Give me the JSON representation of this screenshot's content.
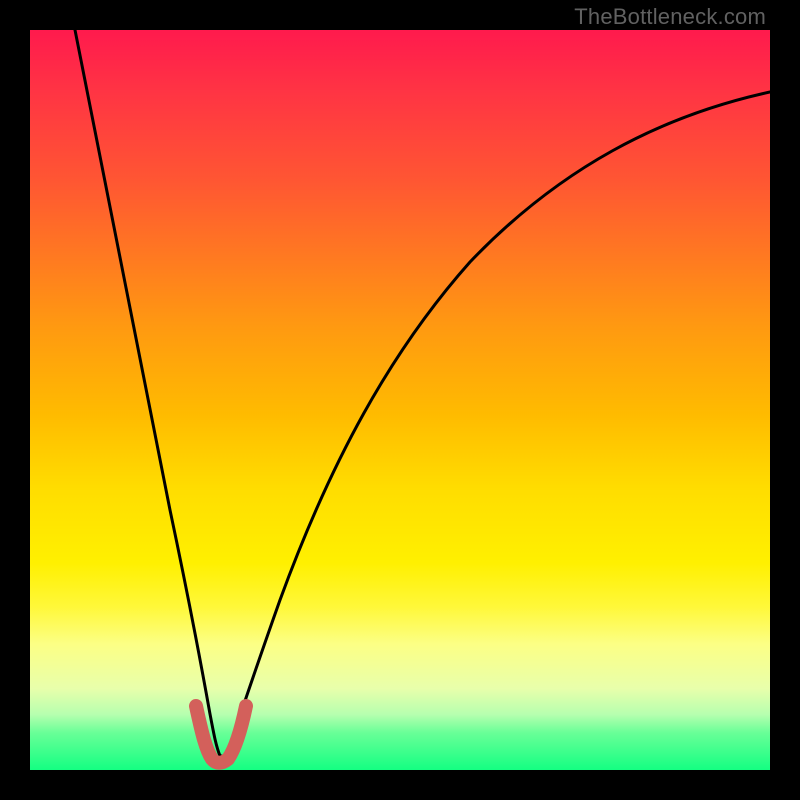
{
  "watermark": "TheBottleneck.com",
  "chart_data": {
    "type": "line",
    "title": "",
    "xlabel": "",
    "ylabel": "",
    "xlim": [
      0,
      100
    ],
    "ylim": [
      0,
      100
    ],
    "series": [
      {
        "name": "bottleneck-curve",
        "x": [
          6,
          8,
          10,
          12,
          14,
          16,
          18,
          20,
          22,
          23.5,
          25,
          27,
          28.5,
          30,
          34,
          40,
          48,
          58,
          70,
          84,
          100
        ],
        "y": [
          100,
          86,
          73,
          61,
          50,
          40,
          31,
          22,
          13,
          7,
          3,
          3,
          7,
          12,
          24,
          38,
          52,
          64,
          74,
          83,
          90
        ]
      },
      {
        "name": "highlight-valley",
        "x": [
          22.5,
          23.5,
          24,
          25,
          26,
          27,
          28,
          28.8
        ],
        "y": [
          8,
          3.5,
          2,
          1.5,
          1.5,
          2,
          3.5,
          8
        ]
      }
    ],
    "colors": {
      "curve": "#000000",
      "highlight": "#d3605b",
      "gradient_top": "#ff1a4d",
      "gradient_bottom": "#14ff82"
    }
  }
}
